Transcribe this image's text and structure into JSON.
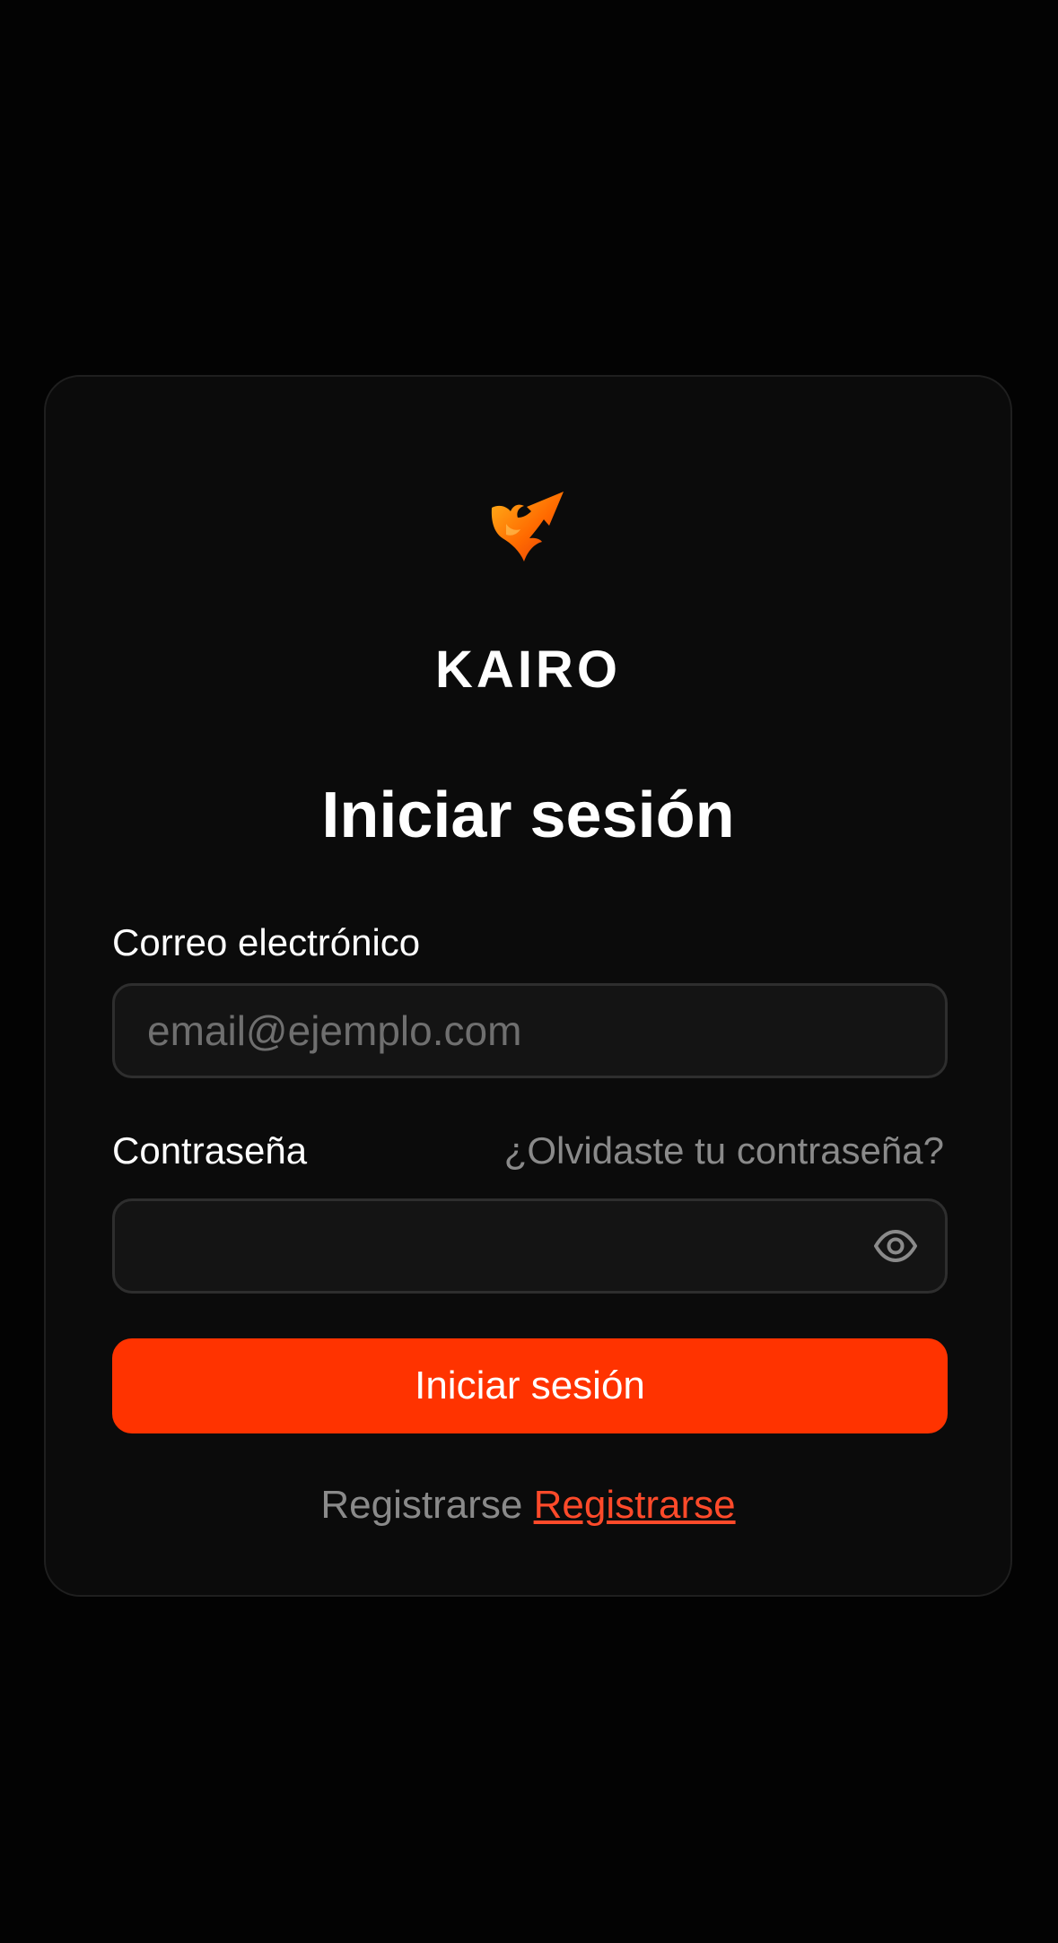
{
  "brand": {
    "name": "KAIRO",
    "logo_icon": "phoenix-arrow-icon",
    "logo_colors": [
      "#ffb21a",
      "#ff6a00",
      "#e2380a"
    ]
  },
  "login": {
    "title": "Iniciar sesión",
    "email_label": "Correo electrónico",
    "email_placeholder": "email@ejemplo.com",
    "email_value": "",
    "password_label": "Contraseña",
    "password_value": "",
    "forgot_link": "¿Olvidaste tu contraseña?",
    "toggle_icon": "eye-icon",
    "submit_label": "Iniciar sesión",
    "register_text": "Registrarse",
    "register_link": "Registrarse"
  },
  "colors": {
    "background": "#030303",
    "card": "#0b0b0b",
    "accent": "#ff3300",
    "link": "#ff4a2a",
    "muted_text": "#8a8a8a"
  }
}
